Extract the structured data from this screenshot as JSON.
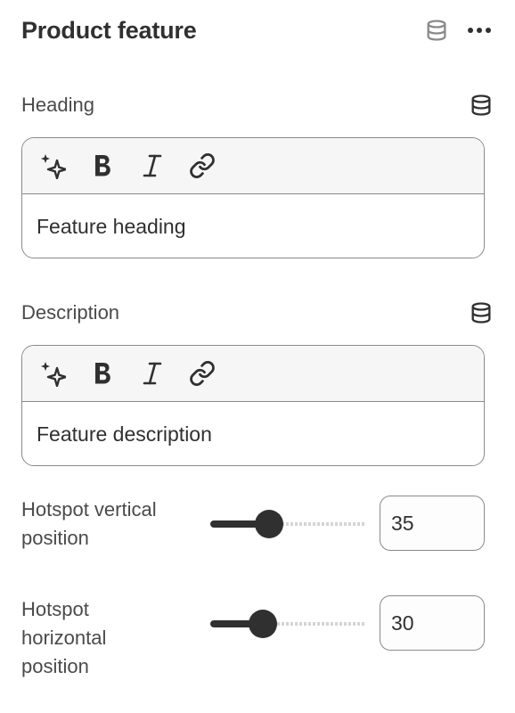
{
  "header": {
    "title": "Product feature",
    "dynamic_source_icon": "database-icon",
    "more_icon": "more-horizontal-icon"
  },
  "fields": {
    "heading": {
      "label": "Heading",
      "value": "Feature heading",
      "toolbar": [
        "sparkle-icon",
        "bold-icon",
        "italic-icon",
        "link-icon"
      ]
    },
    "description": {
      "label": "Description",
      "value": "Feature description",
      "toolbar": [
        "sparkle-icon",
        "bold-icon",
        "italic-icon",
        "link-icon"
      ]
    }
  },
  "ranges": {
    "vertical": {
      "label": "Hotspot vertical position",
      "label_line1": "Hotspot vertical",
      "label_line2": "position",
      "value": "35",
      "percent": 35
    },
    "horizontal": {
      "label": "Hotspot horizontal position",
      "label_line1": "Hotspot",
      "label_line2": "horizontal",
      "label_line3": "position",
      "value": "30",
      "percent": 30
    }
  },
  "colors": {
    "text": "#303030",
    "border": "#8a8a8a",
    "toolbar_bg": "#f6f6f6"
  }
}
